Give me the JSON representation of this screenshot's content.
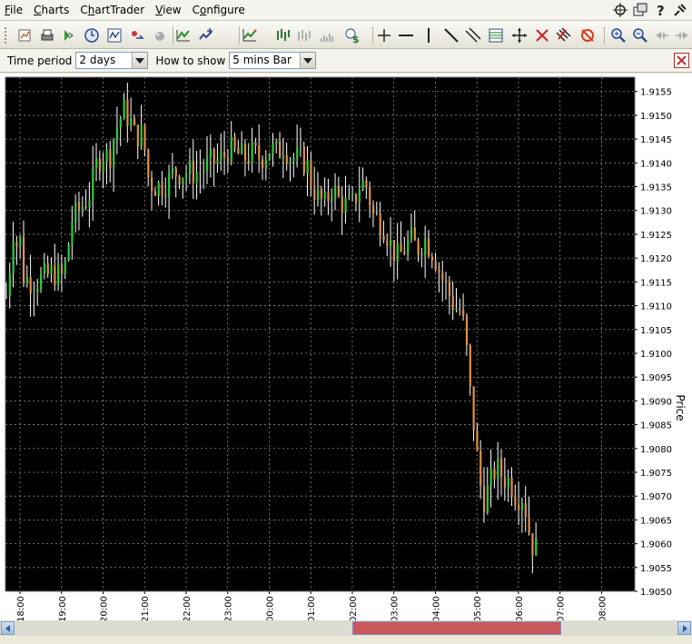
{
  "menu": {
    "items": [
      {
        "pre": "",
        "u": "F",
        "post": "ile"
      },
      {
        "pre": "",
        "u": "C",
        "post": "harts"
      },
      {
        "pre": "C",
        "u": "h",
        "post": "artTrader"
      },
      {
        "pre": "",
        "u": "V",
        "post": "iew"
      },
      {
        "pre": "C",
        "u": "o",
        "post": "nfigure"
      }
    ]
  },
  "window_icons": [
    "crosshair-icon",
    "duplicate-window-icon",
    "help-icon",
    "pin-icon"
  ],
  "options": {
    "time_period_label": "Time period",
    "time_period_value": "2 days",
    "how_to_show_label": "How to show",
    "how_to_show_value": "5 mins Bar"
  },
  "toolbar": {
    "icons": [
      "new-chart-icon",
      "print-icon",
      "sound-icon",
      "clock-icon",
      "chart-type-icon",
      "refresh-icon",
      "ball-icon",
      "indicator-icon",
      "star-indicator-icon",
      "line-chart-icon",
      "ohlc-bar-icon",
      "bar-chart-light-icon",
      "volume-bar-icon",
      "dollar-clock-icon",
      "crosshair-tool-icon",
      "horizontal-line-icon",
      "vertical-line-icon",
      "trend-line-icon",
      "parallel-lines-icon",
      "fibonacci-icon",
      "move-tool-icon",
      "delete-drawing-icon",
      "delete-all-drawings-icon",
      "clear-alarm-icon",
      "zoom-in-icon",
      "zoom-out-icon",
      "scroll-left-icon",
      "scroll-right-icon"
    ]
  },
  "chart_data": {
    "type": "ohlc",
    "ylabel": "Price",
    "ylim": [
      1.905,
      1.9158
    ],
    "y_ticks": [
      "1.9155",
      "1.9150",
      "1.9145",
      "1.9140",
      "1.9135",
      "1.9130",
      "1.9125",
      "1.9120",
      "1.9115",
      "1.9110",
      "1.9105",
      "1.9100",
      "1.9095",
      "1.9090",
      "1.9085",
      "1.9080",
      "1.9075",
      "1.9070",
      "1.9065",
      "1.9060",
      "1.9055",
      "1.9050"
    ],
    "x_ticks": [
      "18:00",
      "19:00",
      "20:00",
      "21:00",
      "22:00",
      "23:00",
      "00:00",
      "01:00",
      "02:00",
      "03:00",
      "04:00",
      "05:00",
      "06:00",
      "07:00",
      "08:00"
    ],
    "x_tick_hours": [
      18,
      19,
      20,
      21,
      22,
      23,
      24,
      25,
      26,
      27,
      28,
      29,
      30,
      31,
      32
    ],
    "x_start_hour": 17.65,
    "x_end_hour": 32.8,
    "bar_minutes": 5,
    "up_color": "#2ecc3a",
    "down_color": "#e0904a",
    "wick_color": "#ffffff",
    "background": "#000000",
    "grid": true,
    "grid_color": "#8a8a8a",
    "close_path": [
      [
        17.67,
        1.9112
      ],
      [
        17.75,
        1.9118
      ],
      [
        17.83,
        1.9126
      ],
      [
        17.92,
        1.9123
      ],
      [
        18.0,
        1.9124
      ],
      [
        18.05,
        1.9117
      ],
      [
        18.1,
        1.9116
      ],
      [
        18.3,
        1.9115
      ],
      [
        18.6,
        1.9116
      ],
      [
        18.8,
        1.9117
      ],
      [
        19.0,
        1.9116
      ],
      [
        19.1,
        1.9119
      ],
      [
        19.25,
        1.9128
      ],
      [
        19.5,
        1.9131
      ],
      [
        19.7,
        1.9134
      ],
      [
        19.85,
        1.914
      ],
      [
        20.0,
        1.9142
      ],
      [
        20.15,
        1.9141
      ],
      [
        20.3,
        1.9147
      ],
      [
        20.5,
        1.9151
      ],
      [
        20.65,
        1.9149
      ],
      [
        20.75,
        1.9146
      ],
      [
        20.95,
        1.9146
      ],
      [
        21.0,
        1.9143
      ],
      [
        21.1,
        1.9136
      ],
      [
        21.3,
        1.9135
      ],
      [
        21.55,
        1.9136
      ],
      [
        21.7,
        1.9138
      ],
      [
        22.0,
        1.9138
      ],
      [
        22.3,
        1.9138
      ],
      [
        22.6,
        1.914
      ],
      [
        22.9,
        1.9141
      ],
      [
        23.0,
        1.9143
      ],
      [
        23.2,
        1.9142
      ],
      [
        23.4,
        1.9141
      ],
      [
        23.6,
        1.9142
      ],
      [
        23.8,
        1.9141
      ],
      [
        24.0,
        1.9143
      ],
      [
        24.2,
        1.9142
      ],
      [
        24.35,
        1.9144
      ],
      [
        24.5,
        1.9141
      ],
      [
        24.7,
        1.9141
      ],
      [
        24.9,
        1.914
      ],
      [
        25.0,
        1.9136
      ],
      [
        25.15,
        1.9133
      ],
      [
        25.35,
        1.9131
      ],
      [
        25.5,
        1.9135
      ],
      [
        25.7,
        1.9132
      ],
      [
        25.85,
        1.9131
      ],
      [
        26.0,
        1.9131
      ],
      [
        26.2,
        1.9136
      ],
      [
        26.35,
        1.9135
      ],
      [
        26.5,
        1.9129
      ],
      [
        26.65,
        1.9128
      ],
      [
        26.8,
        1.9126
      ],
      [
        26.95,
        1.9122
      ],
      [
        27.1,
        1.912
      ],
      [
        27.25,
        1.9122
      ],
      [
        27.4,
        1.9124
      ],
      [
        27.55,
        1.9122
      ],
      [
        27.75,
        1.9124
      ],
      [
        27.9,
        1.9122
      ],
      [
        28.0,
        1.912
      ],
      [
        28.1,
        1.9117
      ],
      [
        28.3,
        1.9113
      ],
      [
        28.45,
        1.911
      ],
      [
        28.6,
        1.9109
      ],
      [
        28.7,
        1.9105
      ],
      [
        28.78,
        1.9098
      ],
      [
        28.85,
        1.909
      ],
      [
        28.95,
        1.9083
      ],
      [
        29.05,
        1.9074
      ],
      [
        29.15,
        1.9069
      ],
      [
        29.3,
        1.9072
      ],
      [
        29.45,
        1.9076
      ],
      [
        29.55,
        1.9075
      ],
      [
        29.65,
        1.9074
      ],
      [
        29.8,
        1.9073
      ],
      [
        29.95,
        1.907
      ],
      [
        30.1,
        1.907
      ],
      [
        30.2,
        1.9066
      ],
      [
        30.3,
        1.906
      ],
      [
        30.42,
        1.9059
      ],
      [
        30.5,
        1.9056
      ]
    ]
  }
}
